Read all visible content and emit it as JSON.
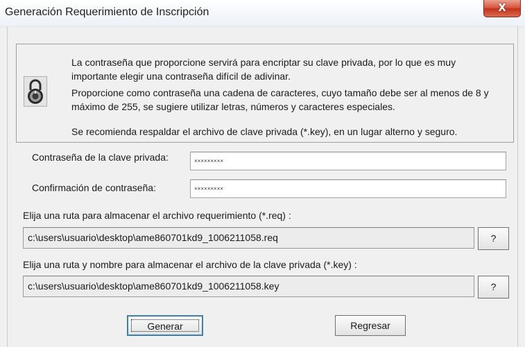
{
  "window": {
    "title": "Generación Requerimiento de Inscripción",
    "close_glyph": "X"
  },
  "info": {
    "paragraph1": "La contraseña que proporcione servirá para encriptar su clave privada, por lo que es muy importante elegir una contraseña difícil de adivinar.",
    "paragraph2": "Proporcione como contraseña una cadena de caracteres, cuyo tamaño debe ser al menos de 8 y máximo de 255, se sugiere utilizar letras, números y caracteres especiales.",
    "paragraph3": "Se recomienda respaldar el archivo de clave privada (*.key), en un lugar alterno y seguro.",
    "icon": "lock-icon"
  },
  "password": {
    "label": "Contraseña de la clave privada:",
    "value": "×××××××××"
  },
  "confirm": {
    "label": "Confirmación de contraseña:",
    "value": "×××××××××"
  },
  "req_path": {
    "label": "Elija una ruta para almacenar el archivo requerimiento (*.req) :",
    "value": "c:\\users\\usuario\\desktop\\ame860701kd9_1006211058.req",
    "browse_label": "?"
  },
  "key_path": {
    "label": "Elija una ruta y nombre para almacenar el archivo de la clave privada (*.key) :",
    "value": "c:\\users\\usuario\\desktop\\ame860701kd9_1006211058.key",
    "browse_label": "?"
  },
  "buttons": {
    "generate": "Generar",
    "back": "Regresar"
  }
}
